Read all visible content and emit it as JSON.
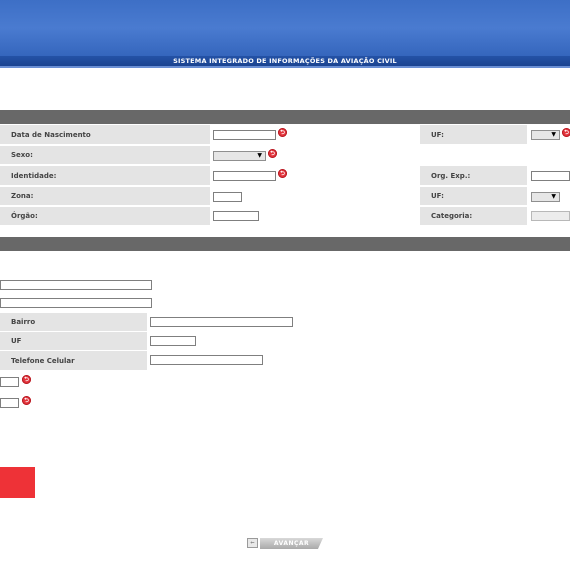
{
  "header": {
    "title": "SISTEMA INTEGRADO DE INFORMAÇÕES DA AVIAÇÃO CIVIL"
  },
  "personal": {
    "birth_date_label": "Data de Nascimento",
    "birth_uf_label": "UF:",
    "sex_label": "Sexo:",
    "identity_label": "Identidade:",
    "issuer_label": "Org. Exp.:",
    "zone_label": "Zona:",
    "zone_uf_label": "UF:",
    "organ_label": "Órgão:",
    "category_label": "Categoria:",
    "select_arrow": "▼"
  },
  "address": {
    "neighborhood_label": "Bairro",
    "uf_label": "UF",
    "mobile_label": "Telefone Celular"
  },
  "footer": {
    "next_label": "AVANÇAR",
    "back_icon": "⇐"
  },
  "icons": {
    "required_glyph": "⮌",
    "required_color": "#e2333b"
  }
}
